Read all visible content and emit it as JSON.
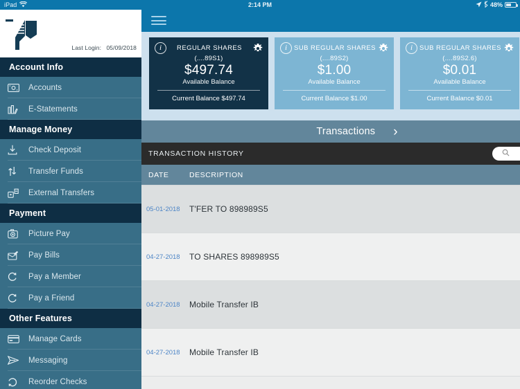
{
  "statusbar": {
    "device": "iPad",
    "wifi_icon": "wifi-icon",
    "time": "2:14 PM",
    "location_icon": "location-arrow-icon",
    "bluetooth_icon": "bluetooth-icon",
    "battery_percent": "48%"
  },
  "sidebar": {
    "logo_name": "bank-logo",
    "last_login_label": "Last Login:",
    "last_login_value": "05/09/2018",
    "sections": [
      {
        "header": "Account Info",
        "items": [
          {
            "label": "Accounts",
            "icon": "money-bill-icon"
          },
          {
            "label": "E-Statements",
            "icon": "statement-icon"
          }
        ]
      },
      {
        "header": "Manage Money",
        "items": [
          {
            "label": "Check Deposit",
            "icon": "download-check-icon"
          },
          {
            "label": "Transfer Funds",
            "icon": "transfer-arrows-icon"
          },
          {
            "label": "External Transfers",
            "icon": "external-transfer-icon"
          }
        ]
      },
      {
        "header": "Payment",
        "items": [
          {
            "label": "Picture Pay",
            "icon": "camera-icon"
          },
          {
            "label": "Pay Bills",
            "icon": "bill-pen-icon"
          },
          {
            "label": "Pay a Member",
            "icon": "refresh-circle-icon"
          },
          {
            "label": "Pay a Friend",
            "icon": "refresh-circle-icon"
          }
        ]
      },
      {
        "header": "Other Features",
        "items": [
          {
            "label": "Manage Cards",
            "icon": "credit-card-icon"
          },
          {
            "label": "Messaging",
            "icon": "paper-plane-icon"
          },
          {
            "label": "Reorder Checks",
            "icon": "reorder-circle-icon"
          }
        ]
      }
    ]
  },
  "navbar": {
    "menu_icon": "hamburger-menu-icon"
  },
  "accounts": [
    {
      "title": "REGULAR SHARES",
      "number": "(....89S1)",
      "amount": "$497.74",
      "available_label": "Available Balance",
      "current_label": "Current Balance $497.74",
      "theme": "dark",
      "info_icon": "info-icon",
      "settings_icon": "gear-icon"
    },
    {
      "title": "SUB REGULAR SHARES",
      "number": "(....89S2)",
      "amount": "$1.00",
      "available_label": "Available Balance",
      "current_label": "Current Balance $1.00",
      "theme": "light",
      "info_icon": "info-icon",
      "settings_icon": "gear-icon"
    },
    {
      "title": "SUB REGULAR SHARES",
      "number": "(....89S2.6)",
      "amount": "$0.01",
      "available_label": "Available Balance",
      "current_label": "Current Balance $0.01",
      "theme": "light",
      "info_icon": "info-icon",
      "settings_icon": "gear-icon"
    }
  ],
  "transactions_bar": {
    "label": "Transactions",
    "chevron_icon": "chevron-right-icon"
  },
  "history": {
    "title": "TRANSACTION HISTORY",
    "search_placeholder": "",
    "search_value": "",
    "search_icon": "search-icon",
    "columns": {
      "date": "DATE",
      "description": "DESCRIPTION"
    },
    "rows": [
      {
        "date": "05-01-2018",
        "description": "T'FER TO 898989S5"
      },
      {
        "date": "04-27-2018",
        "description": "TO SHARES 898989S5"
      },
      {
        "date": "04-27-2018",
        "description": "Mobile Transfer IB"
      },
      {
        "date": "04-27-2018",
        "description": "Mobile Transfer IB"
      }
    ]
  },
  "colors": {
    "status_blue": "#0c76ab",
    "sidebar_blue": "#386e87",
    "section_navy": "#0e2e44",
    "card_navy": "#123247",
    "card_light": "#7db5d3",
    "strip_bg": "#cde0ee",
    "slate": "#62869b",
    "dark_bar": "#2b2b2b",
    "date_blue": "#4d85c6"
  }
}
